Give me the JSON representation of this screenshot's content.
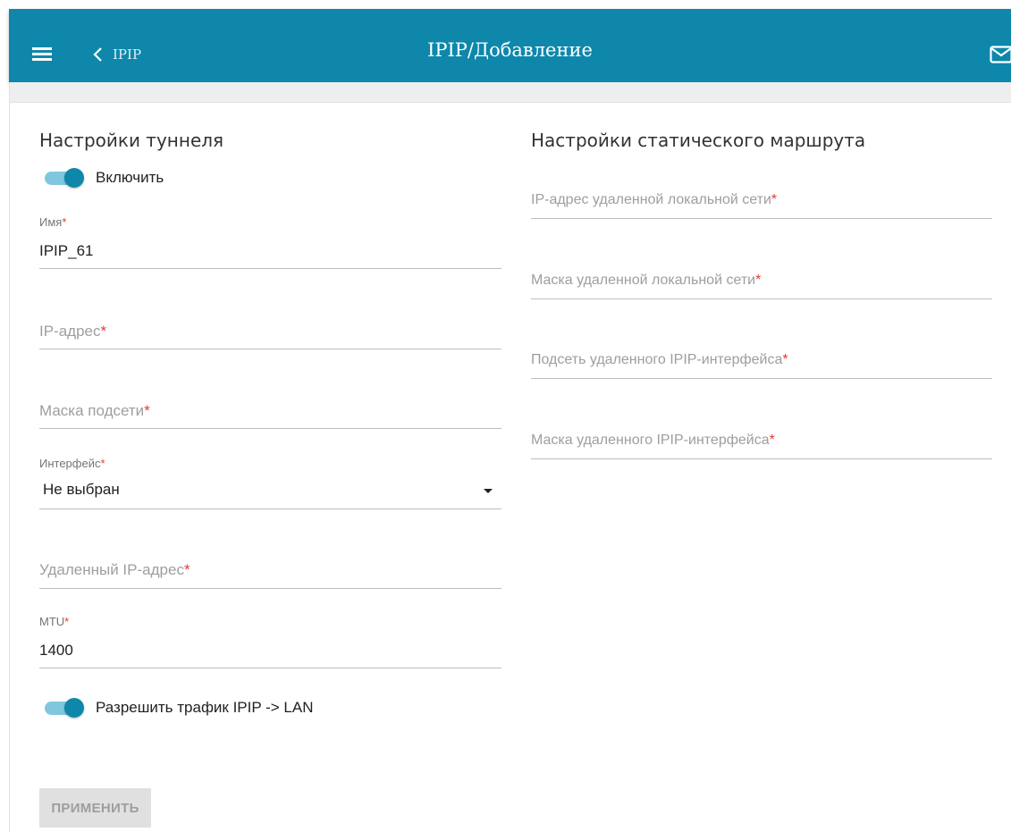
{
  "header": {
    "back_label": "IPIP",
    "title": "IPIP/Добавление"
  },
  "tunnel": {
    "section_title": "Настройки туннеля",
    "enable_label": "Включить",
    "enable_on": true,
    "name": {
      "label": "Имя",
      "value": "IPIP_61"
    },
    "ip": {
      "placeholder": "IP-адрес"
    },
    "mask": {
      "placeholder": "Маска подсети"
    },
    "interface": {
      "label": "Интерфейс",
      "value": "Не выбран"
    },
    "remote_ip": {
      "placeholder": "Удаленный IP-адрес"
    },
    "mtu": {
      "label": "MTU",
      "value": "1400"
    },
    "allow_label": "Разрешить трафик IPIP -> LAN",
    "allow_on": true
  },
  "route": {
    "section_title": "Настройки статического маршрута",
    "remote_lan_ip": {
      "placeholder": "IP-адрес удаленной локальной сети"
    },
    "remote_lan_mask": {
      "placeholder": "Маска удаленной локальной сети"
    },
    "remote_ipip_subnet": {
      "placeholder": "Подсеть удаленного IPIP-интерфейса"
    },
    "remote_ipip_mask": {
      "placeholder": "Маска удаленного IPIP-интерфейса"
    }
  },
  "required_mark": "*",
  "apply_label": "ПРИМЕНИТЬ",
  "colors": {
    "accent": "#0e87ab",
    "required": "#e53935"
  },
  "icons": {
    "menu": "menu-icon",
    "back": "chevron-left-icon",
    "mail": "mail-icon",
    "dropdown": "caret-down-icon"
  }
}
